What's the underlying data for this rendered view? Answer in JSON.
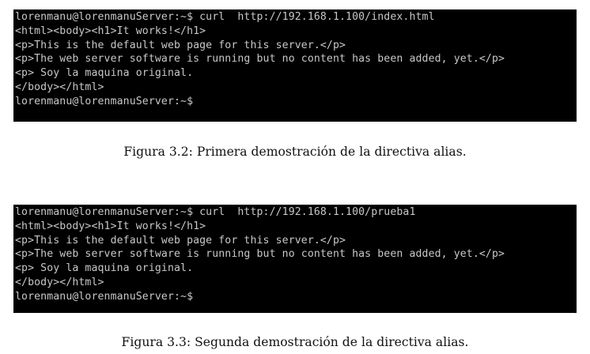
{
  "figures": [
    {
      "terminal_lines": [
        "lorenmanu@lorenmanuServer:~$ curl  http://192.168.1.100/index.html",
        "<html><body><h1>It works!</h1>",
        "<p>This is the default web page for this server.</p>",
        "<p>The web server software is running but no content has been added, yet.</p>",
        "<p> Soy la maquina original.",
        "</body></html>",
        "lorenmanu@lorenmanuServer:~$"
      ],
      "caption": "Figura 3.2: Primera demostración de la directiva alias."
    },
    {
      "terminal_lines": [
        "lorenmanu@lorenmanuServer:~$ curl  http://192.168.1.100/prueba1",
        "<html><body><h1>It works!</h1>",
        "<p>This is the default web page for this server.</p>",
        "<p>The web server software is running but no content has been added, yet.</p>",
        "<p> Soy la maquina original.",
        "</body></html>",
        "lorenmanu@lorenmanuServer:~$"
      ],
      "caption": "Figura 3.3: Segunda demostración de la directiva alias."
    }
  ]
}
